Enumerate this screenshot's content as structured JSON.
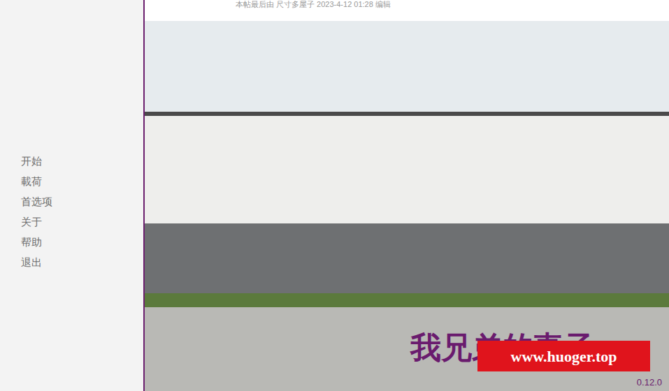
{
  "header": {
    "text": "本帖最后由 尺寸多屋子 2023-4-12 01:28 编辑"
  },
  "menu": {
    "items": [
      {
        "label": "开始"
      },
      {
        "label": "載荷"
      },
      {
        "label": "首选项"
      },
      {
        "label": "关于"
      },
      {
        "label": "帮助"
      },
      {
        "label": "退出"
      }
    ]
  },
  "game": {
    "title": "我兄弟的妻子",
    "version": "0.12.0"
  },
  "watermark": {
    "text": "www.huoger.top"
  }
}
